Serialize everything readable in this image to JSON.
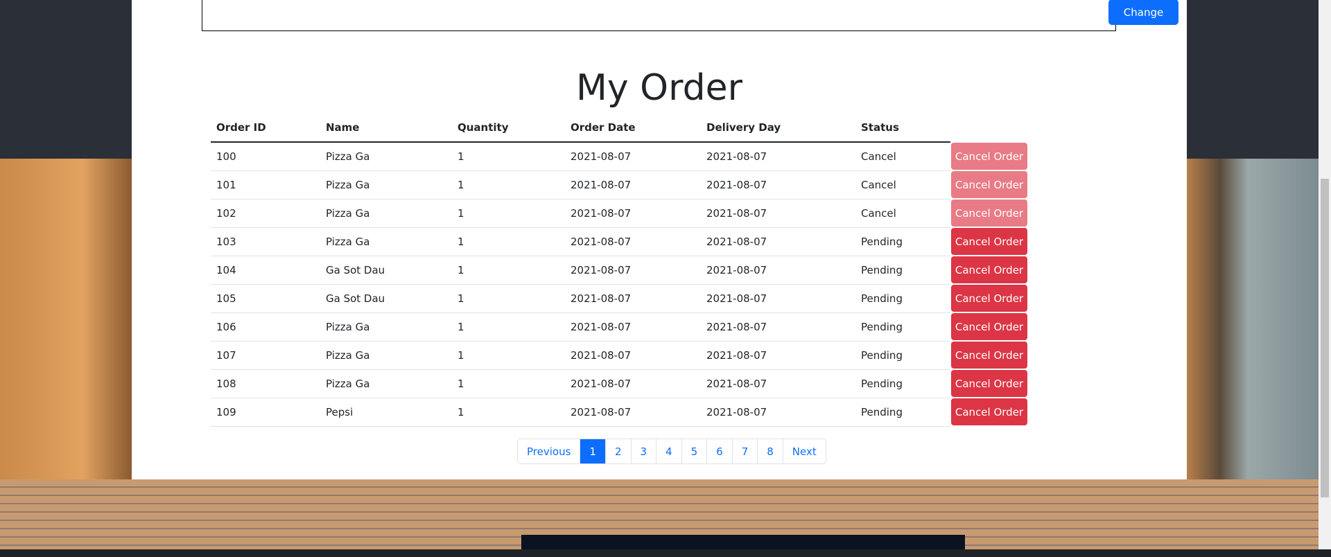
{
  "top": {
    "change_label": "Change"
  },
  "title": "My Order",
  "table": {
    "headers": [
      "Order ID",
      "Name",
      "Quantity",
      "Order Date",
      "Delivery Day",
      "Status"
    ],
    "action_label": "Cancel Order",
    "rows": [
      [
        "100",
        "Pizza Ga",
        "1",
        "2021-08-07",
        "2021-08-07",
        "Cancel"
      ],
      [
        "101",
        "Pizza Ga",
        "1",
        "2021-08-07",
        "2021-08-07",
        "Cancel"
      ],
      [
        "102",
        "Pizza Ga",
        "1",
        "2021-08-07",
        "2021-08-07",
        "Cancel"
      ],
      [
        "103",
        "Pizza Ga",
        "1",
        "2021-08-07",
        "2021-08-07",
        "Pending"
      ],
      [
        "104",
        "Ga Sot Dau",
        "1",
        "2021-08-07",
        "2021-08-07",
        "Pending"
      ],
      [
        "105",
        "Ga Sot Dau",
        "1",
        "2021-08-07",
        "2021-08-07",
        "Pending"
      ],
      [
        "106",
        "Pizza Ga",
        "1",
        "2021-08-07",
        "2021-08-07",
        "Pending"
      ],
      [
        "107",
        "Pizza Ga",
        "1",
        "2021-08-07",
        "2021-08-07",
        "Pending"
      ],
      [
        "108",
        "Pizza Ga",
        "1",
        "2021-08-07",
        "2021-08-07",
        "Pending"
      ],
      [
        "109",
        "Pepsi",
        "1",
        "2021-08-07",
        "2021-08-07",
        "Pending"
      ]
    ]
  },
  "pagination": {
    "previous": "Previous",
    "pages": [
      "1",
      "2",
      "3",
      "4",
      "5",
      "6",
      "7",
      "8"
    ],
    "active": "1",
    "next": "Next"
  },
  "colors": {
    "primary": "#0d6efd",
    "danger": "#dc3545"
  }
}
